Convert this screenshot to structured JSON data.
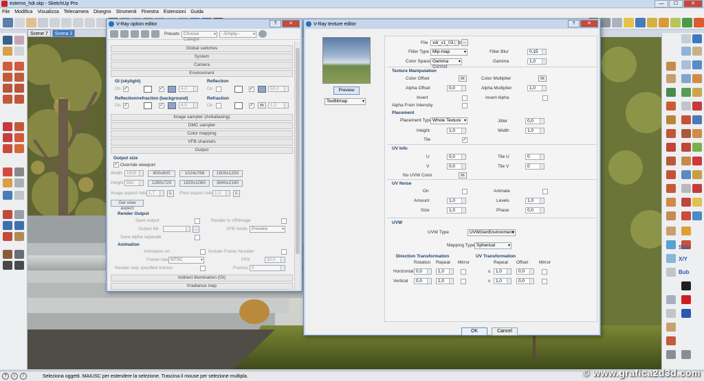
{
  "app": {
    "title": "esterno_hdr.skp - SketchUp Pro",
    "controls": [
      "—",
      "☐",
      "✕"
    ]
  },
  "menu": [
    "File",
    "Modifica",
    "Visualizza",
    "Telecamera",
    "Disegno",
    "Strumenti",
    "Finestra",
    "Estensioni",
    "Guida"
  ],
  "scenes": [
    {
      "label": "Scene 7",
      "active": false
    },
    {
      "label": "Scena 2",
      "active": true
    }
  ],
  "status": {
    "text": "Seleziona oggetti. MAIUSC per estendere la selezione. Trascina il mouse per selezione multipla.",
    "icons": [
      "?",
      "i",
      "!"
    ]
  },
  "watermark": "© www.grafica2d3d.com",
  "vray_options": {
    "title": "V-Ray option editor",
    "title_controls": [
      "?",
      "✕"
    ],
    "presets_label": "Presets",
    "preset_category": "Choose Categor",
    "preset_empty": "--Empty--",
    "rollouts": [
      "Global switches",
      "System",
      "Camera",
      "Environment"
    ],
    "env": {
      "gi_label": "GI (skylight)",
      "reflection_label": "Reflection",
      "reflref_label": "Reflection/refraction (background)",
      "refraction_label": "Refraction",
      "on_label": "On",
      "gi_mult": "4,0",
      "refl_mult": "50,0",
      "rr_mult": "4,0",
      "refr_mult": "1,0",
      "m": "m"
    },
    "rollouts2": [
      "Image sampler (Antialiasing)",
      "DMC sampler",
      "Color mapping",
      "VFB channels",
      "Output"
    ],
    "output": {
      "size_label": "Output size",
      "override_label": "Override viewport",
      "width_label": "Width",
      "width": "1500",
      "height_label": "Height",
      "height": "882",
      "presets_w": [
        "800x600",
        "1024x768",
        "1600x1200"
      ],
      "presets_h": [
        "1280x720",
        "1920x1080",
        "3840x2160"
      ],
      "iar_label": "Image aspect ratio",
      "iar": "1,7",
      "lock1": "L",
      "par_label": "Pixel aspect ratio",
      "par": "1,0",
      "lock2": "L",
      "get_view": "Get view aspect",
      "render_output_label": "Render Output",
      "save_output": "Save output",
      "render_vfb": "Render to VRImage",
      "output_file": "Output file",
      "browse": "...",
      "vfb_mode_label": "VFB mode",
      "vfb_mode": "Preview",
      "save_alpha": "Save alpha separate",
      "animation_label": "Animation",
      "anim_on": "Animation on",
      "include_frame": "Include Frame Number",
      "frame_rate_label": "Frame rate",
      "frame_rate": "NTSC",
      "fps_label": "FPS",
      "fps": "30,0",
      "render_specified": "Render only specified frames",
      "frames_label": "Frames",
      "frames": "0"
    },
    "rollouts3": [
      "Indirect Illumination (GI)",
      "Irradiance map"
    ]
  },
  "vray_texture": {
    "title": "V-Ray texture editor",
    "title_controls": [
      "?",
      "✕"
    ],
    "preview_btn": "Preview",
    "tex_type": "TexBitmap",
    "file_label": "File",
    "file": "xdr_v1_03.hdr",
    "browse": "...",
    "filter_type_label": "Filter Type",
    "filter_type": "Mip-map",
    "filter_blur_label": "Filter Blur",
    "filter_blur": "0,15",
    "color_space_label": "Color Space",
    "color_space": "Gamma Correct",
    "gamma_label": "Gamma",
    "gamma": "1,0",
    "tm_label": "Texture Manipulation",
    "color_offset_label": "Color Offset",
    "color_mult_label": "Color Multiplier",
    "alpha_offset_label": "Alpha Offset",
    "alpha_offset": "0,0",
    "alpha_mult_label": "Alpha Multiplier",
    "alpha_mult": "1,0",
    "invert_label": "Invert",
    "invert_alpha_label": "Invert Alpha",
    "alpha_from_int_label": "Alpha From Intensity",
    "placement_label": "Placement",
    "placement_type_label": "Placement Type",
    "placement_type": "Whole Texture",
    "jitter_label": "Jitter",
    "jitter": "0,0",
    "height_label": "Height",
    "height": "1,0",
    "width_label": "Width",
    "width": "1,0",
    "tile_label": "Tile",
    "uvinfo_label": "UV Info",
    "u_label": "U",
    "u": "0,0",
    "tileu_label": "Tile U",
    "tileu": "0",
    "v_label": "V",
    "v": "0,0",
    "tilev_label": "Tile V",
    "tilev": "0",
    "nouvw_label": "No UVW Color",
    "m": "m",
    "uvnoise_label": "UV Noise",
    "on_label": "On",
    "animate_label": "Animate",
    "amount_label": "Amount",
    "amount": "1,0",
    "levels_label": "Levels",
    "levels": "1,0",
    "size_label": "Size",
    "size": "1,0",
    "phase_label": "Phase",
    "phase": "0,0",
    "uvw_label": "UVW",
    "uvw_type_label": "UVW Type",
    "uvw_type": "UVWGenEnvironment",
    "mapping_type_label": "Mapping Type",
    "mapping_type": "Spherical",
    "dir_label": "Direction Transformation",
    "uv_label": "UV Transformation",
    "rotation": "Rotation",
    "repeat": "Repeat",
    "mirror": "Mirror",
    "offset": "Offset",
    "horizontal": "Horizontal",
    "vertical": "Vertical",
    "h_rot": "0,0",
    "h_rep": "1,0",
    "v_rot": "0,0",
    "v_rep": "1,0",
    "u_small": "u",
    "v_small": "v",
    "u_rep": "1,0",
    "u_off": "0,0",
    "v_off": "0,0",
    "ok": "OK",
    "cancel": "Cancel"
  },
  "right_panel": {
    "labels": [
      "Skin",
      "X/Y",
      "Bub"
    ]
  }
}
